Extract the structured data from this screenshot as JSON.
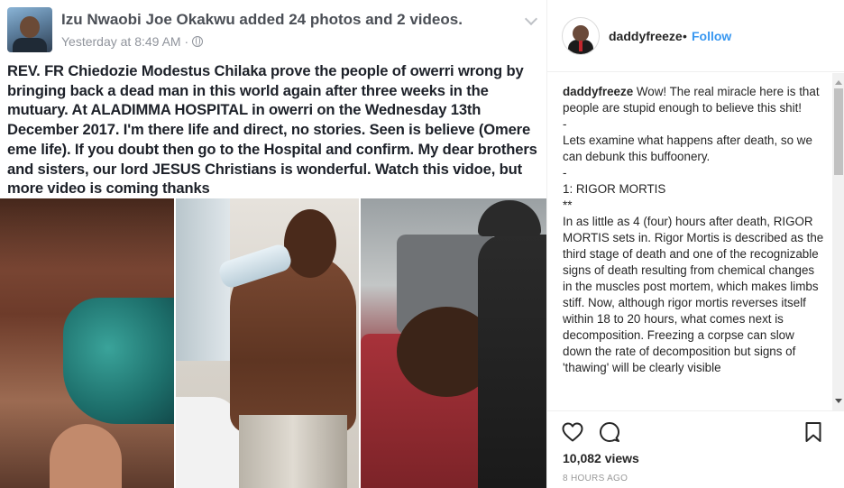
{
  "facebook_post": {
    "author_action": "Izu Nwaobi Joe Okakwu added 24 photos and 2 videos.",
    "timestamp": "Yesterday at 8:49 AM ·",
    "body": "REV. FR Chiedozie Modestus Chilaka prove the people of owerri wrong by bringing back a dead man in this world again after three weeks in the mutuary. At ALADIMMA HOSPITAL in owerri on the Wednesday 13th December 2017. I'm there life and direct,  no stories. Seen is believe (Omere eme life).  If you doubt then go to the Hospital and confirm. My dear brothers and sisters,  our lord JESUS Christians is wonderful. Watch this vidoe, but more video is coming thanks"
  },
  "instagram": {
    "username": "daddyfreeze",
    "separator": "•",
    "follow_label": "Follow",
    "caption_user": "daddyfreeze",
    "caption_text": " Wow! The real miracle here is that people are stupid enough to believe this shit!\n-\nLets examine what happens after death, so we can debunk this buffoonery.\n-\n1: RIGOR MORTIS\n**\nIn as little as 4 (four) hours after death, RIGOR MORTIS sets in. Rigor Mortis is described as the third stage of death and one of the recognizable signs of death resulting from chemical changes in the muscles post mortem, which makes limbs stiff. Now, although rigor mortis reverses itself within 18 to 20 hours, what comes next is decomposition. Freezing a corpse can slow down the rate of decomposition but signs of 'thawing' will be clearly visible",
    "views": "10,082 views",
    "time_ago": "8 HOURS AGO"
  },
  "icons": {
    "like": "heart-icon",
    "comment": "comment-icon",
    "save": "bookmark-icon",
    "privacy": "globe-icon",
    "menu": "chevron-down-icon"
  },
  "colors": {
    "follow": "#3897f0",
    "fb_name": "#4b4f56",
    "fb_meta": "#90949c",
    "text": "#262626"
  }
}
